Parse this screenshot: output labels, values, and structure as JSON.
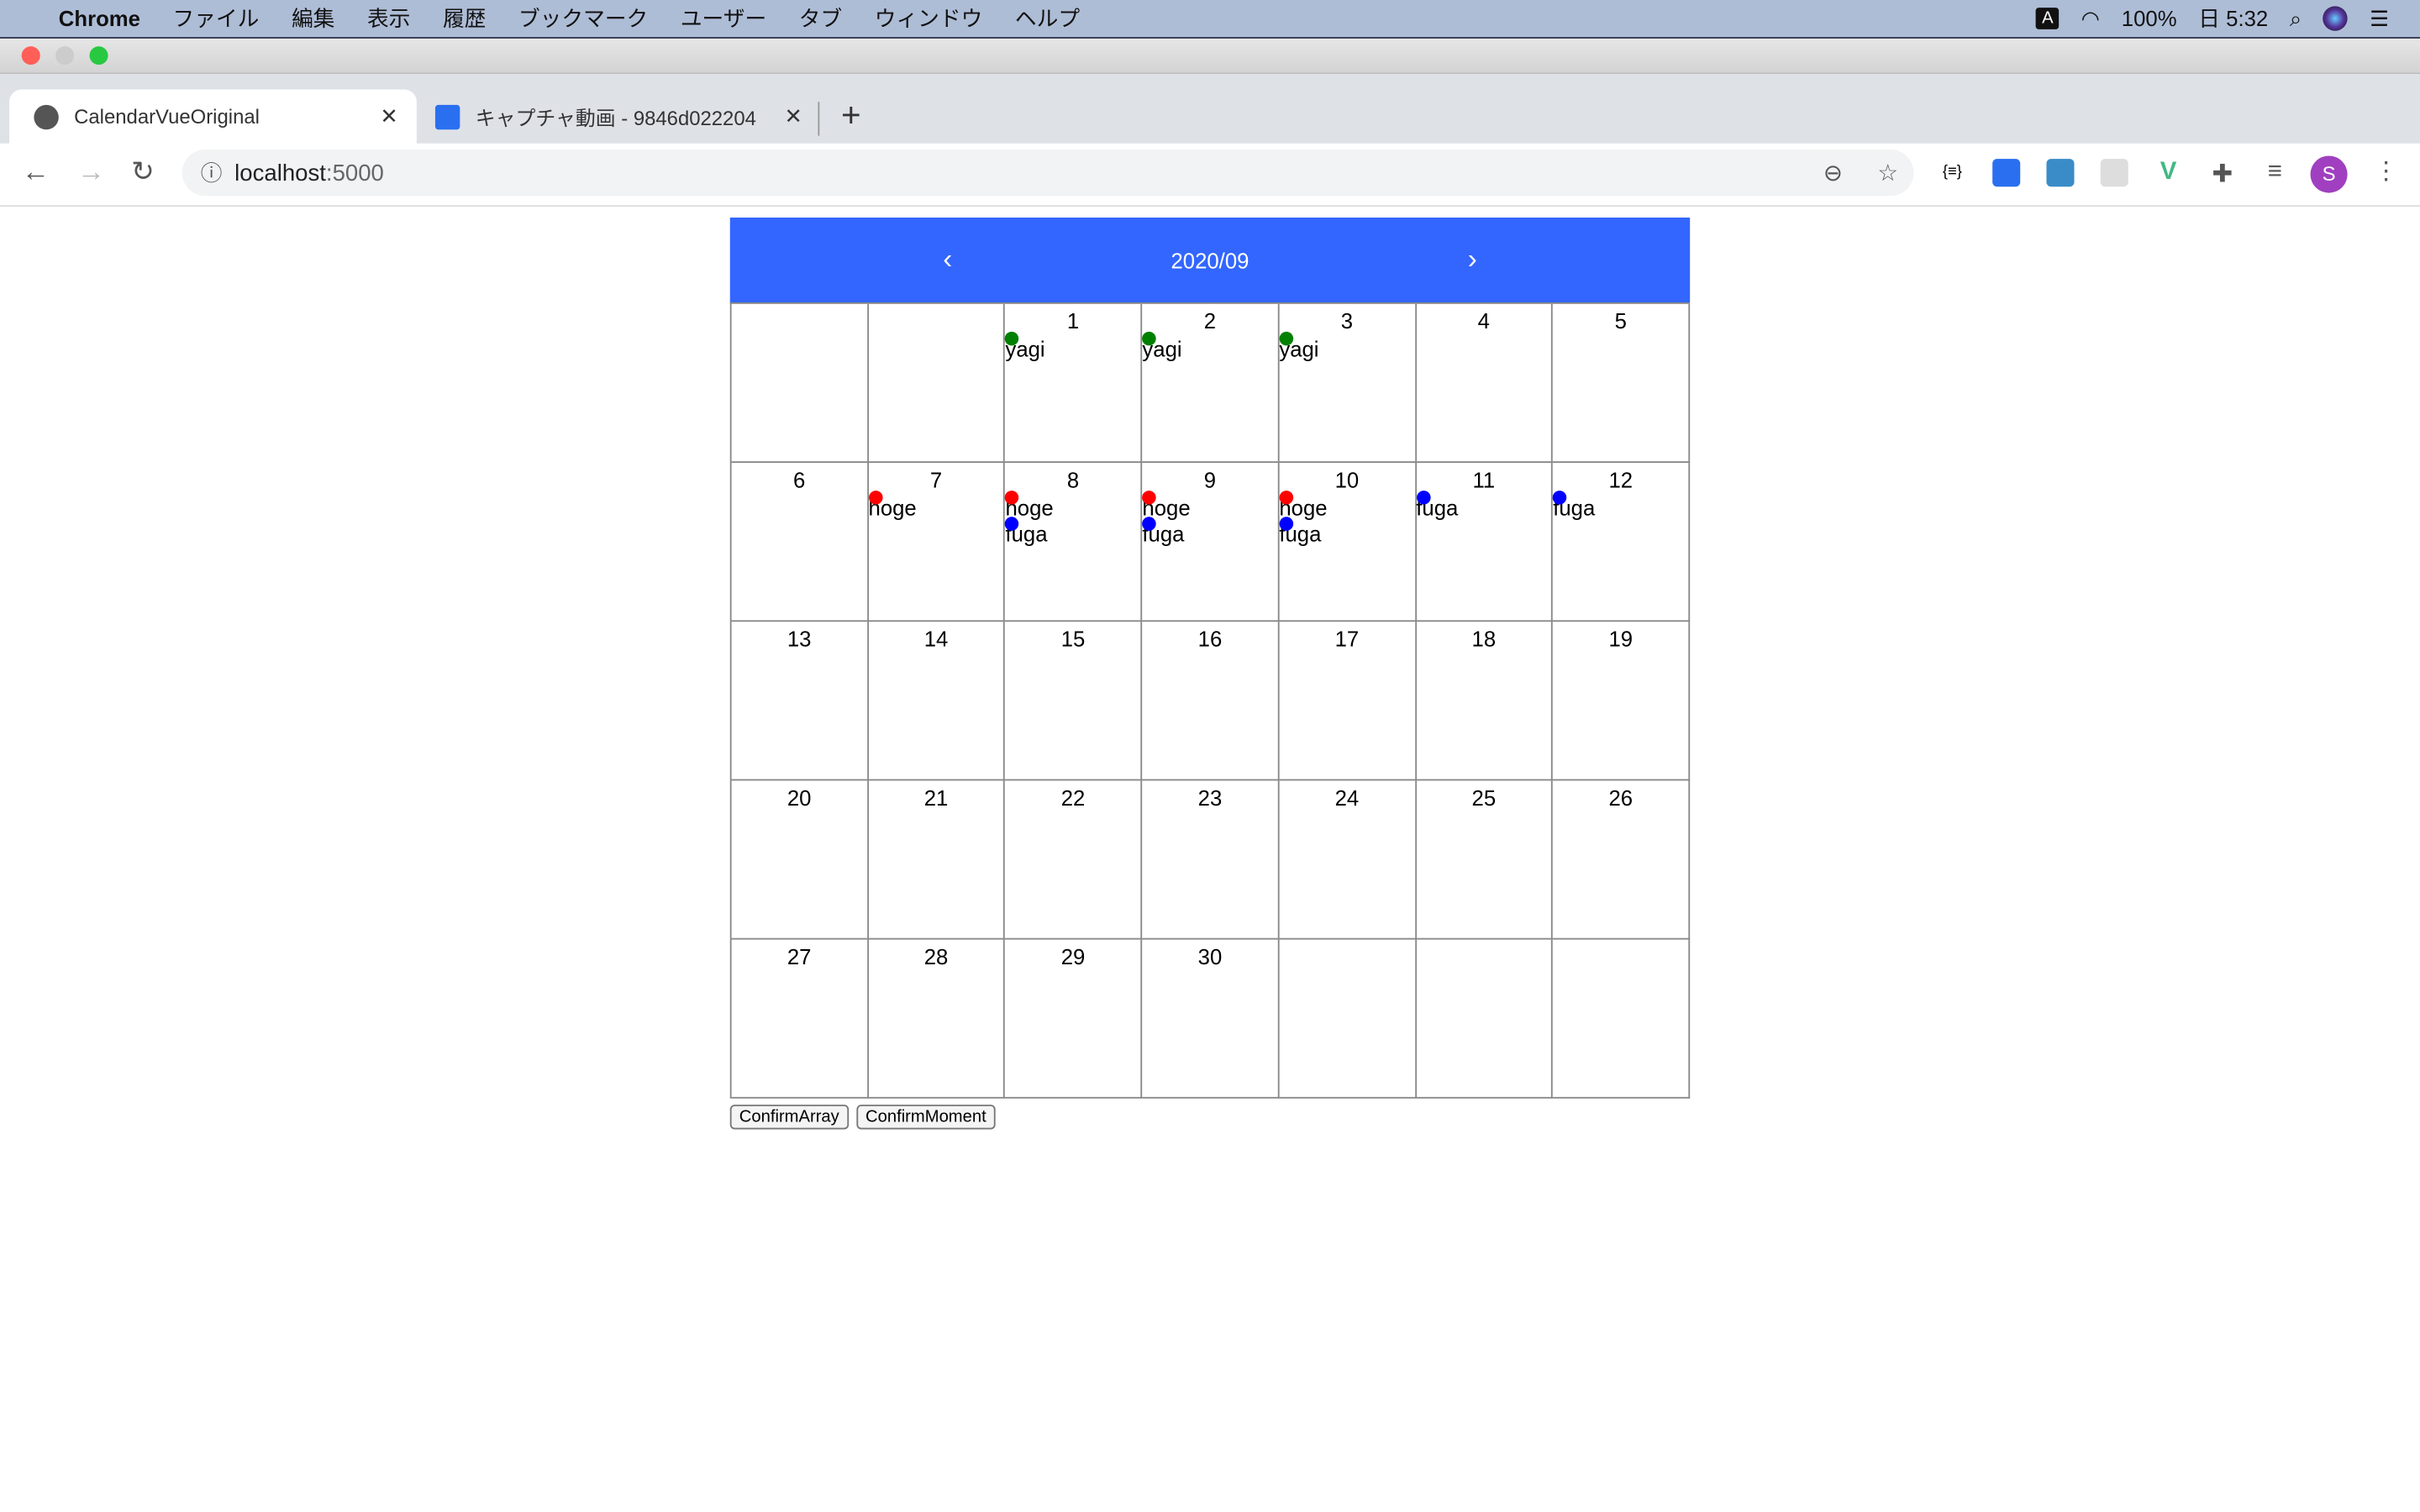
{
  "menubar": {
    "app": "Chrome",
    "items": [
      "ファイル",
      "編集",
      "表示",
      "履歴",
      "ブックマーク",
      "ユーザー",
      "タブ",
      "ウィンドウ",
      "ヘルプ"
    ],
    "input_badge": "A",
    "battery": "100%",
    "clock": "日 5:32"
  },
  "tabs": [
    {
      "label": "CalendarVueOriginal",
      "active": true
    },
    {
      "label": "キャプチャ動画 - 9846d022204",
      "active": false
    }
  ],
  "address": {
    "host": "localhost",
    "port": ":5000"
  },
  "avatar_letter": "S",
  "calendar": {
    "title": "2020/09",
    "prev": "‹",
    "next": "›",
    "colors": {
      "header": "#3366ff",
      "yagi": "#008000",
      "hoge": "#ff0000",
      "fuga": "#0000ff"
    },
    "weeks": [
      [
        {
          "d": ""
        },
        {
          "d": ""
        },
        {
          "d": "1",
          "ev": [
            "yagi"
          ]
        },
        {
          "d": "2",
          "ev": [
            "yagi"
          ]
        },
        {
          "d": "3",
          "ev": [
            "yagi"
          ]
        },
        {
          "d": "4"
        },
        {
          "d": "5"
        }
      ],
      [
        {
          "d": "6"
        },
        {
          "d": "7",
          "ev": [
            "hoge"
          ]
        },
        {
          "d": "8",
          "ev": [
            "hoge",
            "fuga"
          ]
        },
        {
          "d": "9",
          "ev": [
            "hoge",
            "fuga"
          ]
        },
        {
          "d": "10",
          "ev": [
            "hoge",
            "fuga"
          ]
        },
        {
          "d": "11",
          "ev": [
            "fuga"
          ]
        },
        {
          "d": "12",
          "ev": [
            "fuga"
          ]
        }
      ],
      [
        {
          "d": "13"
        },
        {
          "d": "14"
        },
        {
          "d": "15"
        },
        {
          "d": "16"
        },
        {
          "d": "17"
        },
        {
          "d": "18"
        },
        {
          "d": "19"
        }
      ],
      [
        {
          "d": "20"
        },
        {
          "d": "21"
        },
        {
          "d": "22"
        },
        {
          "d": "23"
        },
        {
          "d": "24"
        },
        {
          "d": "25"
        },
        {
          "d": "26"
        }
      ],
      [
        {
          "d": "27"
        },
        {
          "d": "28"
        },
        {
          "d": "29"
        },
        {
          "d": "30"
        },
        {
          "d": ""
        },
        {
          "d": ""
        },
        {
          "d": ""
        }
      ]
    ]
  },
  "buttons": {
    "confirm_array": "ConfirmArray",
    "confirm_moment": "ConfirmMoment"
  }
}
